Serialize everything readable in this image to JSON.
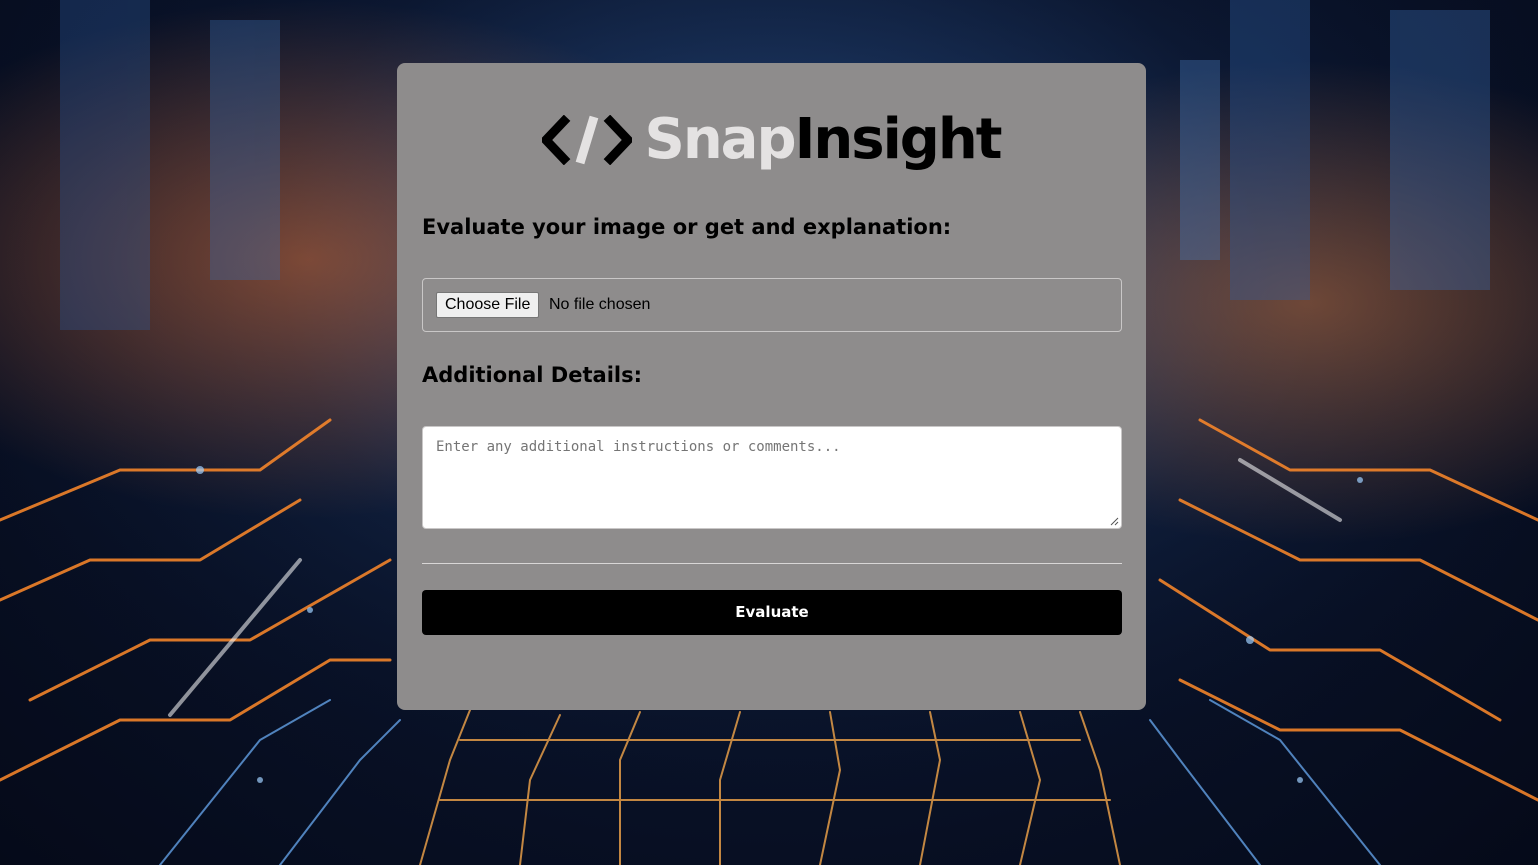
{
  "brand": {
    "logo_icon": "code-brackets-icon",
    "name_part1": "Snap",
    "name_part2": "Insight",
    "color_part1": "#e4e2e2",
    "color_part2": "#000000"
  },
  "form": {
    "image_label": "Evaluate your image or get and explanation:",
    "file_button_label": "Choose File",
    "file_status": "No file chosen",
    "details_label": "Additional Details:",
    "details_placeholder": "Enter any additional instructions or comments...",
    "details_value": "",
    "submit_label": "Evaluate"
  },
  "theme": {
    "card_background": "#8e8c8c",
    "button_background": "#000000",
    "button_text": "#ffffff"
  }
}
